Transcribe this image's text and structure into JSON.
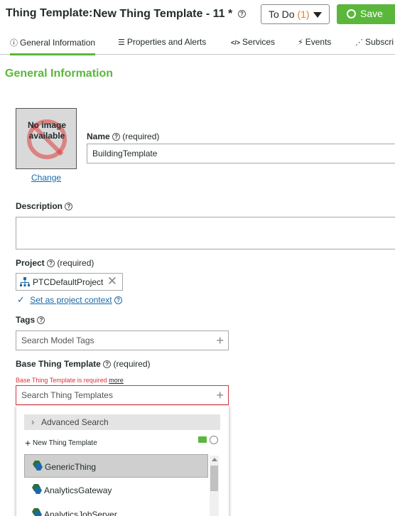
{
  "header": {
    "label": "Thing Template:",
    "name": "New Thing Template - 11",
    "dirty_marker": "*",
    "todo_label": "To Do",
    "todo_count": "(1)",
    "save_label": "Save"
  },
  "tabs": [
    {
      "label": "General Information",
      "icon": "info-icon"
    },
    {
      "label": "Properties and Alerts",
      "icon": "list-icon"
    },
    {
      "label": "Services",
      "icon": "code-icon"
    },
    {
      "label": "Events",
      "icon": "lightning-icon"
    },
    {
      "label": "Subscri",
      "icon": "feed-icon"
    }
  ],
  "section_title": "General Information",
  "image": {
    "placeholder_text": "No image available",
    "change_label": "Change"
  },
  "name_field": {
    "label": "Name",
    "required": "(required)",
    "value": "BuildingTemplate"
  },
  "description_field": {
    "label": "Description",
    "value": ""
  },
  "project_field": {
    "label": "Project",
    "required": "(required)",
    "value": "PTCDefaultProject",
    "context_link": "Set as project context"
  },
  "tags_field": {
    "label": "Tags",
    "placeholder": "Search Model Tags"
  },
  "base_template_field": {
    "label": "Base Thing Template",
    "required": "(required)",
    "error": "Base Thing Template is required",
    "error_more": "more",
    "placeholder": "Search Thing Templates"
  },
  "dropdown": {
    "advanced_search": "Advanced Search",
    "new_template": "New Thing Template",
    "items": [
      "GenericThing",
      "AnalyticsGateway",
      "AnalyticsJobServer"
    ]
  },
  "colors": {
    "accent": "#5bb73b",
    "link": "#1a6aa8",
    "error": "#d9343c",
    "todo_count": "#e67e22"
  }
}
